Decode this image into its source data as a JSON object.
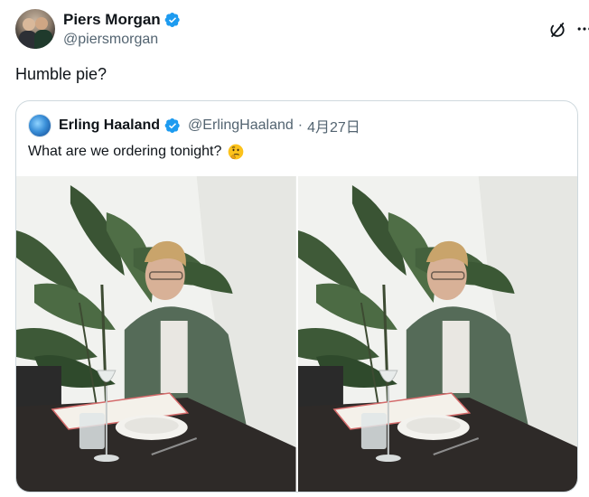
{
  "author": {
    "display_name": "Piers Morgan",
    "handle": "@piersmorgan",
    "verified": true
  },
  "tweet": {
    "text": "Humble pie?"
  },
  "quote": {
    "display_name": "Erling Haaland",
    "handle": "@ErlingHaaland",
    "separator": "·",
    "date": "4月27日",
    "text": "What are we ordering tonight?",
    "emoji": "thinking-face"
  },
  "media": {
    "count": 2,
    "items": [
      {
        "alt": "photo-1"
      },
      {
        "alt": "photo-2"
      }
    ]
  },
  "icons": {
    "verified": "verified-badge-icon",
    "grok": "grok-icon",
    "more": "more-icon"
  },
  "colors": {
    "text": "#0f1419",
    "secondary": "#536471",
    "verified_blue": "#1d9bf0",
    "border": "#cfd9de"
  }
}
